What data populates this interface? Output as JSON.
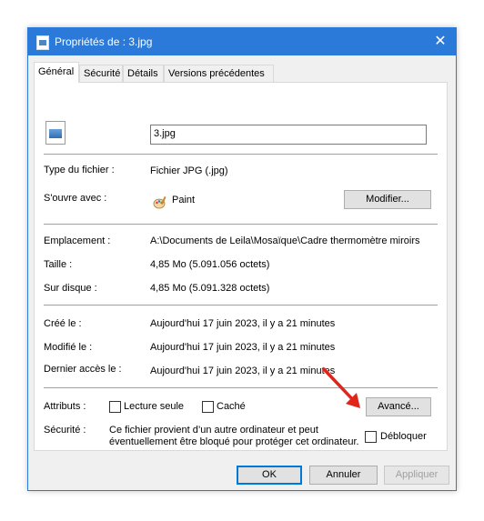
{
  "window": {
    "title": "Propriétés de : 3.jpg"
  },
  "tabs": [
    "Général",
    "Sécurité",
    "Détails",
    "Versions précédentes"
  ],
  "general": {
    "filename": "3.jpg",
    "type_label": "Type du fichier :",
    "type_value": "Fichier JPG (.jpg)",
    "opens_label": "S'ouvre avec :",
    "opens_value": "Paint",
    "change_button": "Modifier...",
    "location_label": "Emplacement :",
    "location_value": "A:\\Documents de Leila\\Mosaïque\\Cadre thermomètre miroirs",
    "size_label": "Taille :",
    "size_value": "4,85 Mo (5.091.056 octets)",
    "disk_label": "Sur disque :",
    "disk_value": "4,85 Mo (5.091.328 octets)",
    "created_label": "Créé le :",
    "created_value": "Aujourd'hui 17 juin 2023, il y a 21 minutes",
    "modified_label": "Modifié le :",
    "modified_value": "Aujourd'hui 17 juin 2023, il y a 21 minutes",
    "accessed_label": "Dernier accès le :",
    "accessed_value": "Aujourd'hui 17 juin 2023, il y a 21 minutes",
    "attributes_label": "Attributs :",
    "readonly_label": "Lecture seule",
    "hidden_label": "Caché",
    "advanced_button": "Avancé...",
    "security_label": "Sécurité :",
    "security_text_line1": "Ce fichier provient d’un autre ordinateur et peut",
    "security_text_line2": "éventuellement être bloqué pour protéger cet ordinateur.",
    "unblock_label": "Débloquer"
  },
  "footer": {
    "ok": "OK",
    "cancel": "Annuler",
    "apply": "Appliquer"
  },
  "colors": {
    "titlebar": "#2b79d8",
    "arrow": "#e0261b"
  }
}
